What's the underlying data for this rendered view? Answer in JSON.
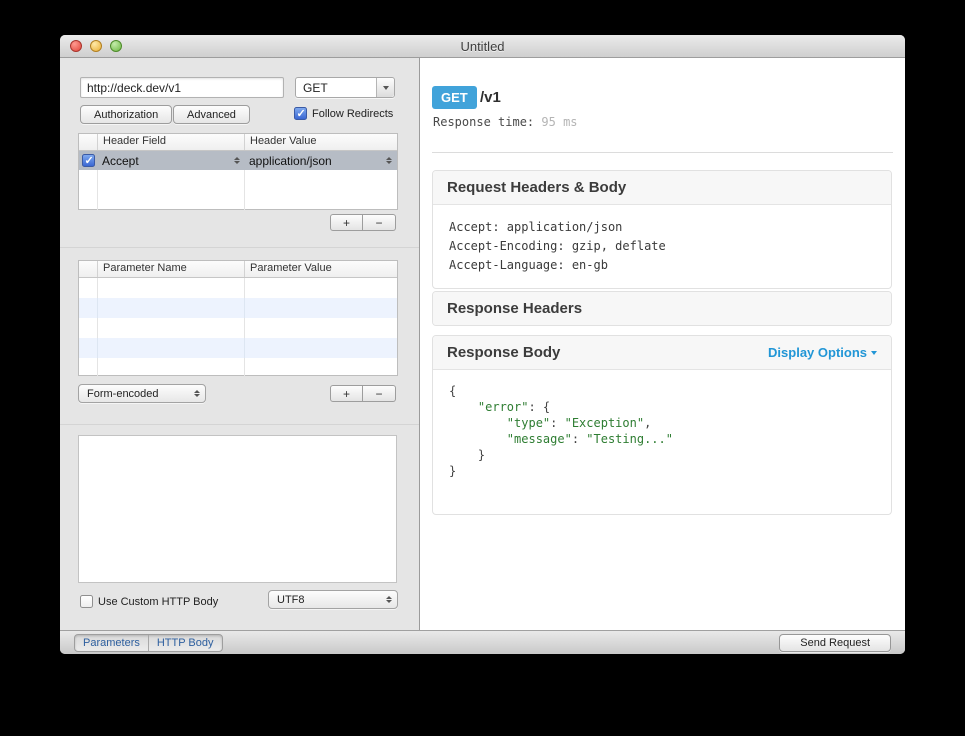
{
  "window": {
    "title": "Untitled"
  },
  "request": {
    "url": "http://deck.dev/v1",
    "method": "GET",
    "authorization_label": "Authorization",
    "advanced_label": "Advanced",
    "follow_redirects_label": "Follow Redirects",
    "headers_table": {
      "columns": [
        "Header Field",
        "Header Value"
      ],
      "rows": [
        {
          "field": "Accept",
          "value": "application/json",
          "checked": true
        }
      ]
    },
    "params_table": {
      "columns": [
        "Parameter Name",
        "Parameter Value"
      ]
    },
    "encoding": "Form-encoded",
    "charset": "UTF8",
    "custom_body_label": "Use Custom HTTP Body",
    "add_label": "+",
    "remove_label": "−"
  },
  "toolbar": {
    "segments": [
      "Parameters",
      "HTTP Body"
    ],
    "send_label": "Send Request"
  },
  "response": {
    "method": "GET",
    "path": "/v1",
    "time_label": "Response time:",
    "time_value": "95 ms",
    "request_headers": {
      "title": "Request Headers & Body",
      "lines": [
        "Accept: application/json",
        "Accept-Encoding: gzip, deflate",
        "Accept-Language: en-gb"
      ]
    },
    "response_headers": {
      "title": "Response Headers"
    },
    "response_body": {
      "title": "Response Body",
      "display_options_label": "Display Options",
      "body_text": "{\n    \"error\": {\n        \"type\": \"Exception\",\n        \"message\": \"Testing...\"\n    }\n}"
    }
  },
  "colors": {
    "method_badge": "#41a3da",
    "link_blue": "#2196d6",
    "json_string_green": "#2e7d32"
  }
}
